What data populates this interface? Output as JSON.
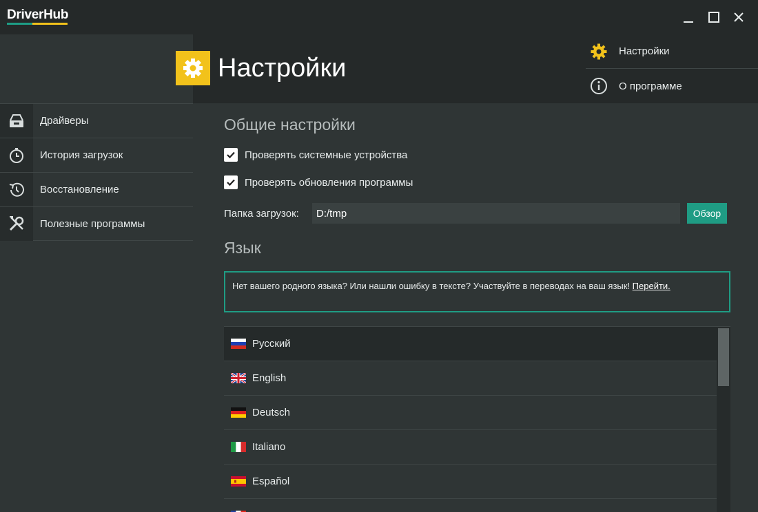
{
  "app": {
    "logo": "DriverHub",
    "brand_colors": {
      "teal": "#1e9e86",
      "yellow": "#f2c21b"
    }
  },
  "window_controls": {
    "minimize": "minimize-icon",
    "maximize": "maximize-icon",
    "close": "close-icon"
  },
  "header": {
    "title": "Настройки"
  },
  "topnav": {
    "items": [
      {
        "label": "Настройки",
        "icon": "gear-icon"
      },
      {
        "label": "О программе",
        "icon": "info-icon"
      }
    ]
  },
  "sidebar": {
    "items": [
      {
        "label": "Драйверы",
        "icon": "drive-tray-icon"
      },
      {
        "label": "История загрузок",
        "icon": "stopwatch-icon"
      },
      {
        "label": "Восстановление",
        "icon": "history-restore-icon"
      },
      {
        "label": "Полезные программы",
        "icon": "tools-icon"
      }
    ]
  },
  "general": {
    "title": "Общие настройки",
    "check_devices": {
      "label": "Проверять системные устройства",
      "checked": true
    },
    "check_updates": {
      "label": "Проверять обновления программы",
      "checked": true
    },
    "folder": {
      "label": "Папка загрузок:",
      "value": "D:/tmp",
      "browse_label": "Обзор"
    }
  },
  "language": {
    "title": "Язык",
    "notice_text": "Нет вашего родного языка? Или нашли ошибку в тексте? Участвуйте в переводах на ваш язык! ",
    "notice_link": "Перейти.",
    "items": [
      {
        "label": "Русский",
        "flag": "flag-ru-icon",
        "selected": true
      },
      {
        "label": "English",
        "flag": "flag-gb-icon",
        "selected": false
      },
      {
        "label": "Deutsch",
        "flag": "flag-de-icon",
        "selected": false
      },
      {
        "label": "Italiano",
        "flag": "flag-it-icon",
        "selected": false
      },
      {
        "label": "Español",
        "flag": "flag-es-icon",
        "selected": false
      }
    ]
  }
}
